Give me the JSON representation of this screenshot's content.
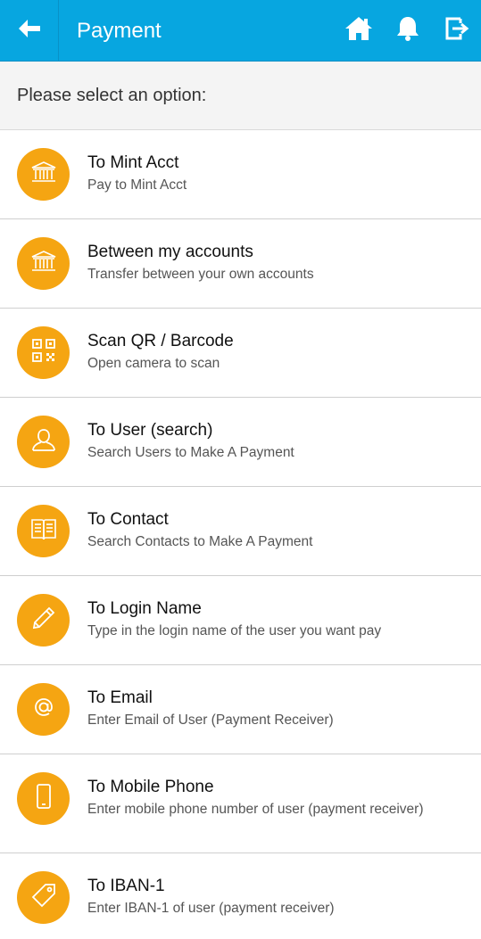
{
  "header": {
    "title": "Payment",
    "accent_color": "#07a6e0",
    "icons": [
      "back-arrow-icon",
      "home-icon",
      "bell-icon",
      "logout-icon"
    ]
  },
  "prompt": "Please select an option:",
  "icon_color": "#f5a512",
  "options": [
    {
      "title": "To Mint Acct",
      "subtitle": "Pay to Mint Acct",
      "icon": "bank-icon"
    },
    {
      "title": "Between my accounts",
      "subtitle": "Transfer between your own accounts",
      "icon": "bank-icon"
    },
    {
      "title": "Scan QR / Barcode",
      "subtitle": "Open camera to scan",
      "icon": "qr-code-icon"
    },
    {
      "title": "To User (search)",
      "subtitle": "Search Users to Make A Payment",
      "icon": "user-icon"
    },
    {
      "title": "To Contact",
      "subtitle": "Search Contacts to Make A Payment",
      "icon": "contact-book-icon"
    },
    {
      "title": "To Login Name",
      "subtitle": "Type in the login name of the user you want pay",
      "icon": "pencil-icon"
    },
    {
      "title": "To Email",
      "subtitle": "Enter Email of User (Payment Receiver)",
      "icon": "at-sign-icon"
    },
    {
      "title": "To Mobile Phone",
      "subtitle": "Enter mobile phone number of user (payment receiver)",
      "icon": "mobile-phone-icon"
    },
    {
      "title": "To IBAN-1",
      "subtitle": "Enter IBAN-1 of user (payment receiver)",
      "icon": "tag-icon"
    }
  ]
}
